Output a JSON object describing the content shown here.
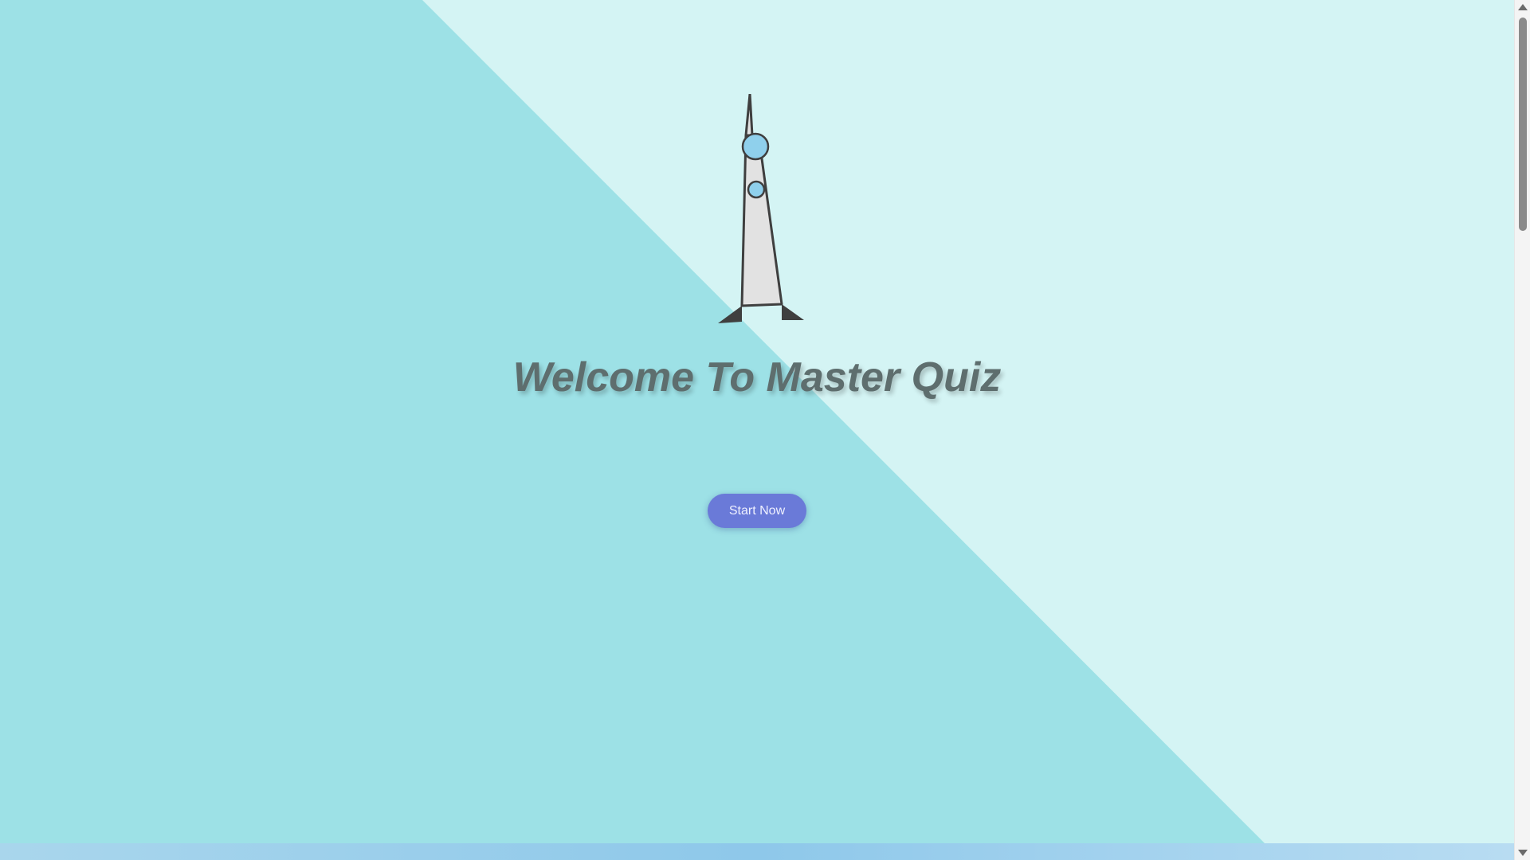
{
  "page": {
    "title": "Welcome To Master Quiz",
    "start_button_label": "Start Now"
  },
  "colors": {
    "background_light": "#d4f4f4",
    "background_diagonal": "#9de1e6",
    "title_text": "#5e6e6e",
    "button_bg": "#6a7ad8",
    "button_text": "#eef0ff",
    "tower_body": "#e2e2e2",
    "tower_outline": "#3f3f3f",
    "tower_pods": "#8fd0ec"
  },
  "icons": {
    "logo": "tower-icon",
    "scroll_up": "scroll-up-arrow-icon",
    "scroll_down": "scroll-down-arrow-icon"
  },
  "scrollbar": {
    "position_fraction": 0.0
  }
}
